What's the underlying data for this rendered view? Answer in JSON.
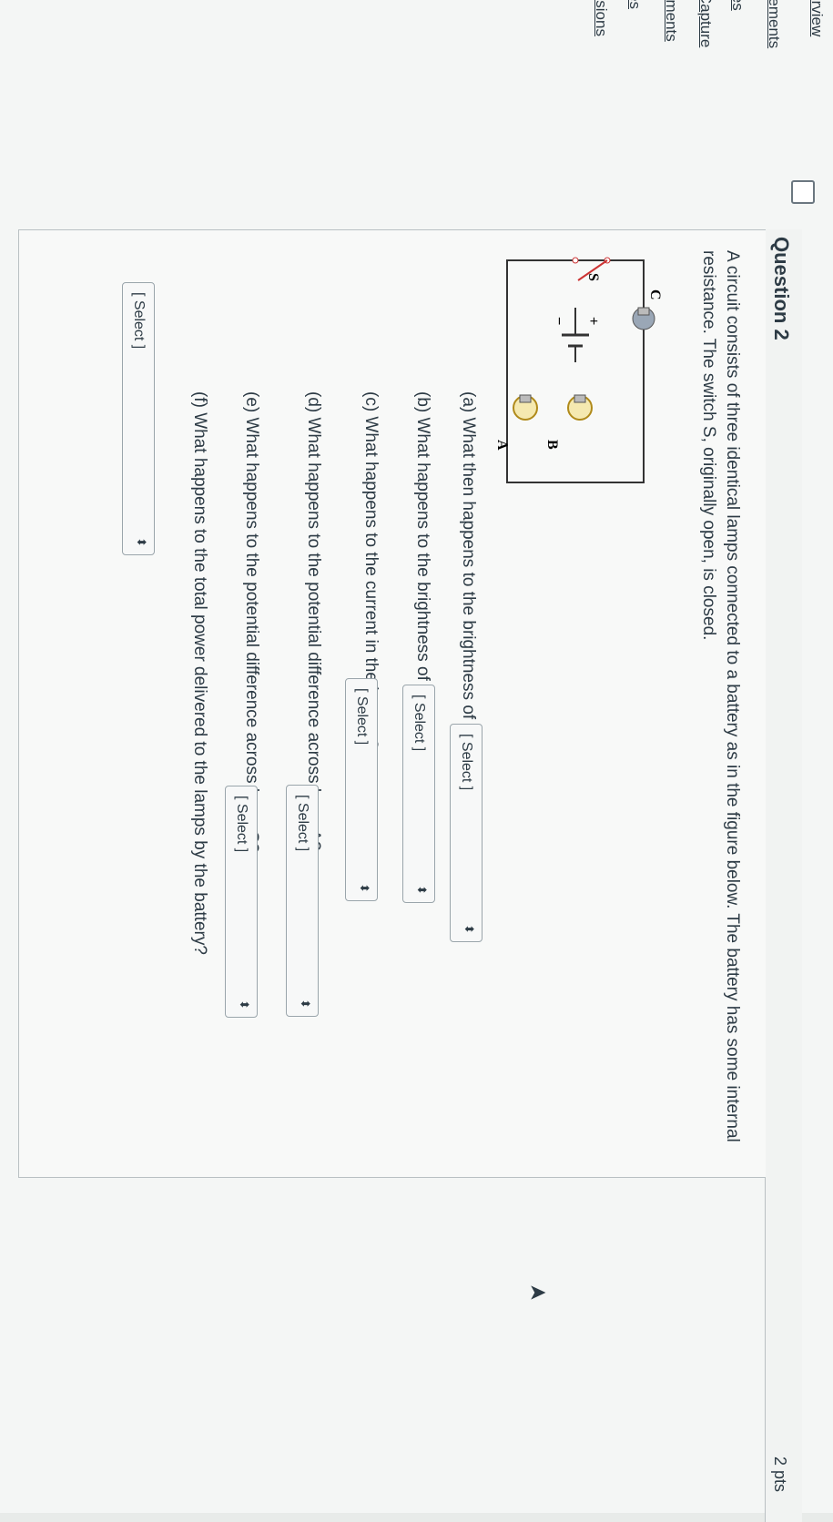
{
  "nav": {
    "items": [
      "t Overview",
      "uncements",
      "les",
      "re Capture",
      "nments",
      "es",
      "issions"
    ]
  },
  "question": {
    "title": "Question 2",
    "points": "2 pts",
    "prompt": "A circuit consists of three identical lamps connected to a battery as in the figure below. The battery has some internal resistance. The switch S, originally open, is closed."
  },
  "figure": {
    "labels": {
      "lamp_a": "A",
      "lamp_b": "B",
      "lamp_c": "C",
      "switch": "S",
      "plus": "+",
      "minus": "−"
    }
  },
  "subquestions": [
    {
      "text": "(a) What then happens to the brightness of lamp B?",
      "select_value": "[ Select ]"
    },
    {
      "text": "(b) What happens to the brightness of lamp C?",
      "select_value": "[ Select ]"
    },
    {
      "text": "(c) What happens to the current in the battery?",
      "select_value": "[ Select ]"
    },
    {
      "text": "(d) What happens to the potential difference across lamp A?",
      "select_value": "[ Select ]"
    },
    {
      "text": "(e) What happens to the potential difference across lamp C?",
      "select_value": "[ Select ]"
    },
    {
      "text": "(f) What happens to the total power delivered to the lamps by the battery?",
      "select_value": "[ Select ]"
    }
  ]
}
